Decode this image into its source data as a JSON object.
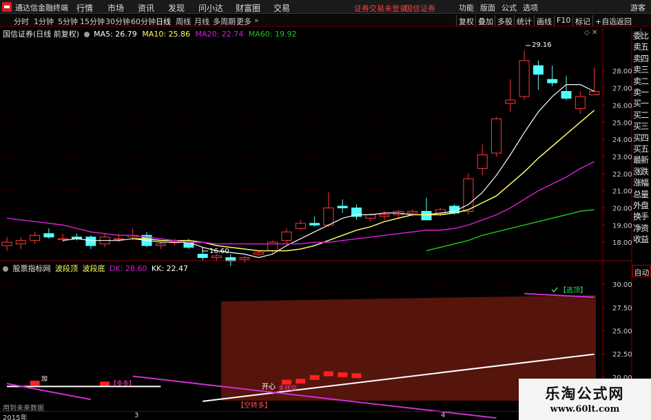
{
  "app": {
    "title": "通达信金融终端"
  },
  "menu": [
    "行情",
    "市场",
    "资讯",
    "发现",
    "问小达",
    "财富圈",
    "交易"
  ],
  "notices": [
    "证券交易未登录",
    "国信证券"
  ],
  "right_menu": [
    "功能",
    "版面",
    "公式",
    "选项"
  ],
  "guest_label": "游客",
  "periods": [
    "分时",
    "1分钟",
    "5分钟",
    "15分钟",
    "30分钟",
    "60分钟",
    "日线",
    "周线",
    "月线",
    "多周期",
    "更多"
  ],
  "active_period": "日线",
  "toolbar_buttons": [
    "复权",
    "叠加",
    "多股",
    "统计",
    "画线",
    "F10",
    "标记",
    "+自选",
    "返回"
  ],
  "main_chart": {
    "title": "国信证券(日线 前复权)",
    "ma": [
      {
        "label": "MA5: 26.79",
        "color": "#ffffff"
      },
      {
        "label": "MA10: 25.86",
        "color": "#ffff66"
      },
      {
        "label": "MA20: 22.74",
        "color": "#d020d0"
      },
      {
        "label": "MA60: 19.92",
        "color": "#20c020"
      }
    ],
    "high_label": "29.16",
    "low_label": "16.60"
  },
  "sub_chart": {
    "title": "股票指标网",
    "name1": "波段顶",
    "name2": "波段底",
    "dk": "DK: 28.60",
    "kk": "KK: 22.47",
    "annotations": {
      "tiaotao": "【逃顶】",
      "kongzhuanduo": "【空转多】",
      "duoduo": "【多多】",
      "duozhuankong": "多转空",
      "kaixin": "开心",
      "jiucang": "【空转多】",
      "jia": "加"
    }
  },
  "sidebar_items": [
    "委比",
    "卖五",
    "卖四",
    "卖三",
    "卖二",
    "卖一",
    "买一",
    "买二",
    "买三",
    "买四",
    "买五",
    "最新",
    "涨跌",
    "涨幅",
    "总量",
    "外盘",
    "换手",
    "净资",
    "收益"
  ],
  "auto_label": "自动",
  "footer_note": "用到未来数据",
  "time_labels": [
    "2015年",
    "3",
    "4"
  ],
  "watermark": {
    "title": "乐淘公式网",
    "url": "www.60lt.com"
  },
  "chart_data": [
    {
      "type": "candlestick",
      "title": "国信证券(日线 前复权)",
      "ylim": [
        17.0,
        29.8
      ],
      "yticks": [
        18.0,
        19.0,
        20.0,
        21.0,
        22.0,
        23.0,
        24.0,
        25.0,
        26.0,
        27.0,
        28.0
      ],
      "candles": [
        {
          "o": 17.8,
          "h": 18.3,
          "l": 17.5,
          "c": 18.0
        },
        {
          "o": 17.9,
          "h": 18.3,
          "l": 17.6,
          "c": 18.1
        },
        {
          "o": 18.1,
          "h": 18.6,
          "l": 17.9,
          "c": 18.4
        },
        {
          "o": 18.5,
          "h": 18.8,
          "l": 18.2,
          "c": 18.3
        },
        {
          "o": 18.2,
          "h": 18.5,
          "l": 18.0,
          "c": 18.2
        },
        {
          "o": 18.3,
          "h": 18.5,
          "l": 18.1,
          "c": 18.2
        },
        {
          "o": 18.3,
          "h": 18.4,
          "l": 17.6,
          "c": 17.8
        },
        {
          "o": 17.9,
          "h": 18.5,
          "l": 17.7,
          "c": 18.3
        },
        {
          "o": 18.2,
          "h": 18.5,
          "l": 18.0,
          "c": 18.2
        },
        {
          "o": 18.3,
          "h": 18.8,
          "l": 18.1,
          "c": 18.4
        },
        {
          "o": 18.4,
          "h": 18.6,
          "l": 17.7,
          "c": 17.8
        },
        {
          "o": 17.8,
          "h": 18.0,
          "l": 17.6,
          "c": 17.9
        },
        {
          "o": 18.0,
          "h": 18.2,
          "l": 17.8,
          "c": 18.0
        },
        {
          "o": 18.0,
          "h": 18.2,
          "l": 17.6,
          "c": 17.7
        },
        {
          "o": 17.3,
          "h": 17.6,
          "l": 16.9,
          "c": 17.1
        },
        {
          "o": 17.1,
          "h": 17.3,
          "l": 16.9,
          "c": 17.2
        },
        {
          "o": 17.1,
          "h": 17.3,
          "l": 16.6,
          "c": 16.9
        },
        {
          "o": 17.0,
          "h": 17.2,
          "l": 16.8,
          "c": 17.1
        },
        {
          "o": 17.3,
          "h": 17.5,
          "l": 17.2,
          "c": 17.4
        },
        {
          "o": 17.5,
          "h": 18.1,
          "l": 17.3,
          "c": 18.0
        },
        {
          "o": 18.1,
          "h": 18.8,
          "l": 17.9,
          "c": 18.6
        },
        {
          "o": 18.8,
          "h": 19.3,
          "l": 18.7,
          "c": 19.1
        },
        {
          "o": 19.1,
          "h": 19.5,
          "l": 18.9,
          "c": 19.0
        },
        {
          "o": 19.0,
          "h": 20.9,
          "l": 18.9,
          "c": 20.0
        },
        {
          "o": 20.1,
          "h": 20.5,
          "l": 19.7,
          "c": 20.0
        },
        {
          "o": 20.0,
          "h": 20.2,
          "l": 19.3,
          "c": 19.5
        },
        {
          "o": 19.4,
          "h": 19.7,
          "l": 19.2,
          "c": 19.6
        },
        {
          "o": 19.5,
          "h": 19.8,
          "l": 19.3,
          "c": 19.6
        },
        {
          "o": 19.6,
          "h": 19.9,
          "l": 19.4,
          "c": 19.8
        },
        {
          "o": 19.7,
          "h": 19.9,
          "l": 19.5,
          "c": 19.8
        },
        {
          "o": 19.8,
          "h": 20.6,
          "l": 19.6,
          "c": 19.3
        },
        {
          "o": 19.7,
          "h": 20.0,
          "l": 19.5,
          "c": 19.9
        },
        {
          "o": 20.1,
          "h": 20.2,
          "l": 19.6,
          "c": 19.7
        },
        {
          "o": 19.8,
          "h": 22.0,
          "l": 19.6,
          "c": 21.7
        },
        {
          "o": 22.3,
          "h": 23.7,
          "l": 21.9,
          "c": 23.1
        },
        {
          "o": 23.2,
          "h": 25.3,
          "l": 23.0,
          "c": 25.2
        },
        {
          "o": 26.1,
          "h": 27.5,
          "l": 25.6,
          "c": 26.3
        },
        {
          "o": 26.5,
          "h": 29.2,
          "l": 26.3,
          "c": 28.6
        },
        {
          "o": 28.3,
          "h": 28.6,
          "l": 26.9,
          "c": 27.8
        },
        {
          "o": 27.5,
          "h": 28.3,
          "l": 27.1,
          "c": 27.3
        },
        {
          "o": 26.8,
          "h": 27.7,
          "l": 26.3,
          "c": 26.4
        },
        {
          "o": 25.8,
          "h": 26.8,
          "l": 25.5,
          "c": 26.5
        },
        {
          "o": 26.6,
          "h": 28.2,
          "l": 26.6,
          "c": 26.8
        }
      ],
      "series": [
        {
          "name": "MA5",
          "color": "#ffffff",
          "values": [
            null,
            null,
            null,
            null,
            18.1,
            18.2,
            18.1,
            18.1,
            18.1,
            18.2,
            18.1,
            18.0,
            18.0,
            18.0,
            17.7,
            17.5,
            17.4,
            17.3,
            17.1,
            17.3,
            17.8,
            18.2,
            18.6,
            19.0,
            19.4,
            19.6,
            19.6,
            19.7,
            19.7,
            19.6,
            19.6,
            19.7,
            19.8,
            20.2,
            20.9,
            21.9,
            23.1,
            24.4,
            25.6,
            26.5,
            27.2,
            27.2,
            26.8
          ]
        },
        {
          "name": "MA10",
          "color": "#ffff66",
          "values": [
            null,
            null,
            null,
            null,
            null,
            null,
            null,
            null,
            null,
            18.2,
            18.2,
            18.1,
            18.1,
            18.1,
            18.0,
            17.8,
            17.7,
            17.6,
            17.5,
            17.5,
            17.5,
            17.6,
            17.8,
            18.1,
            18.4,
            18.7,
            18.9,
            19.2,
            19.4,
            19.6,
            19.6,
            19.6,
            19.7,
            19.9,
            20.3,
            20.7,
            21.4,
            22.1,
            22.9,
            23.6,
            24.3,
            25.0,
            25.7
          ]
        },
        {
          "name": "MA20",
          "color": "#d020d0",
          "values": [
            19.4,
            19.3,
            19.2,
            19.1,
            19.0,
            18.8,
            18.6,
            18.5,
            18.4,
            18.4,
            18.3,
            18.2,
            18.1,
            18.0,
            18.0,
            17.9,
            17.9,
            17.9,
            17.9,
            17.9,
            17.9,
            17.9,
            18.0,
            18.0,
            18.1,
            18.2,
            18.3,
            18.4,
            18.5,
            18.6,
            18.7,
            18.7,
            18.8,
            19.0,
            19.3,
            19.6,
            20.0,
            20.5,
            21.0,
            21.4,
            21.8,
            22.3,
            22.7
          ]
        },
        {
          "name": "MA60",
          "color": "#20c020",
          "values": [
            null,
            null,
            null,
            null,
            null,
            null,
            null,
            null,
            null,
            null,
            null,
            null,
            null,
            null,
            null,
            null,
            null,
            null,
            null,
            null,
            null,
            null,
            null,
            null,
            null,
            null,
            null,
            null,
            null,
            null,
            17.5,
            17.7,
            17.9,
            18.1,
            18.4,
            18.6,
            18.8,
            19.0,
            19.2,
            19.4,
            19.6,
            19.8,
            19.9
          ]
        }
      ]
    },
    {
      "type": "line",
      "title": "股票指标网",
      "ylim": [
        16.5,
        31.5
      ],
      "yticks": [
        20.0,
        22.5,
        25.0,
        27.5,
        30.0
      ],
      "series": [
        {
          "name": "DK",
          "color": "#ffffff",
          "points": [
            [
              0,
              19.0
            ],
            [
              11,
              19.0
            ],
            [
              14,
              17.4
            ],
            [
              42,
              22.47
            ]
          ]
        },
        {
          "name": "KK",
          "color": "#d030d0",
          "points": [
            [
              0,
              19.3
            ],
            [
              6,
              17.6
            ],
            [
              9,
              20.1
            ],
            [
              16,
              18.6
            ],
            [
              35,
              15.6
            ],
            [
              37,
              29.0
            ],
            [
              42,
              28.6
            ]
          ]
        }
      ],
      "bars": [
        {
          "x": 2,
          "value": 19.1
        },
        {
          "x": 7,
          "value": 19.0
        },
        {
          "x": 20,
          "value": 19.2
        },
        {
          "x": 21,
          "value": 19.3
        },
        {
          "x": 22,
          "value": 19.7
        },
        {
          "x": 23,
          "value": 20.1
        },
        {
          "x": 24,
          "value": 20.0
        },
        {
          "x": 25,
          "value": 19.9
        }
      ]
    }
  ]
}
